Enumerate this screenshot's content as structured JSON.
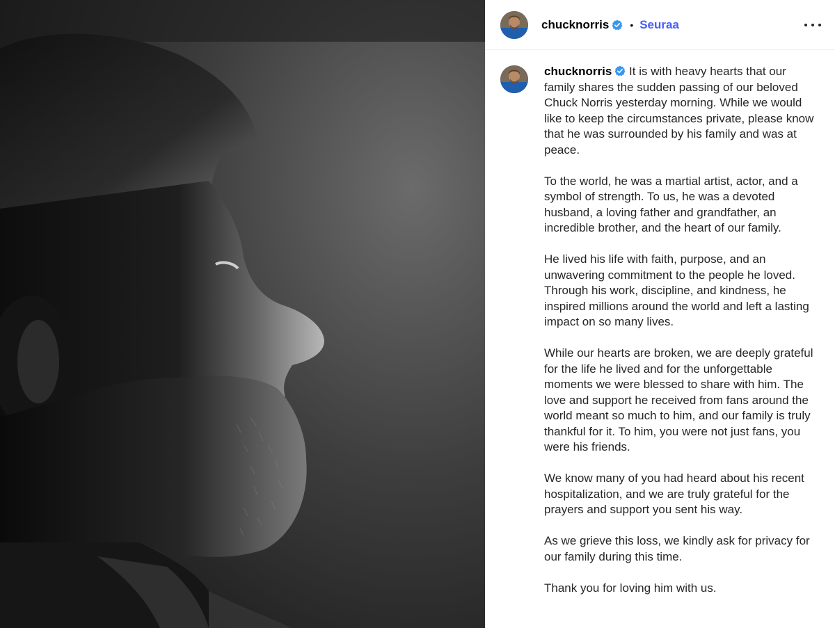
{
  "header": {
    "username": "chucknorris",
    "separator": "•",
    "follow_label": "Seuraa",
    "more_icon": "more-horizontal-icon"
  },
  "caption": {
    "username": "chucknorris",
    "paragraphs": [
      "It is with heavy hearts that our family shares the sudden passing of our beloved Chuck Norris yesterday morning. While we would like to keep the circumstances private, please know that he was surrounded by his family and was at peace.",
      "To the world, he was a martial artist, actor, and a symbol of strength. To us, he was a devoted husband, a loving father and grandfather, an incredible brother, and the heart of our family.",
      "He lived his life with faith, purpose, and an unwavering commitment to the people he loved. Through his work, discipline, and kindness, he inspired millions around the world and left a lasting impact on so many lives.",
      "While our hearts are broken, we are deeply grateful for the life he lived and for the unforgettable moments we were blessed to share with him. The love and support he received from fans around the world meant so much to him, and our family is truly thankful for it. To him, you were not just fans, you were his friends.",
      "We know many of you had heard about his recent hospitalization, and we are truly grateful for the prayers and support you sent his way.",
      "As we grieve this loss, we kindly ask for privacy for our family during this time.",
      "Thank you for loving him with us."
    ]
  },
  "colors": {
    "follow": "#4a5df9",
    "verified": "#3897f0",
    "text": "#262626"
  }
}
